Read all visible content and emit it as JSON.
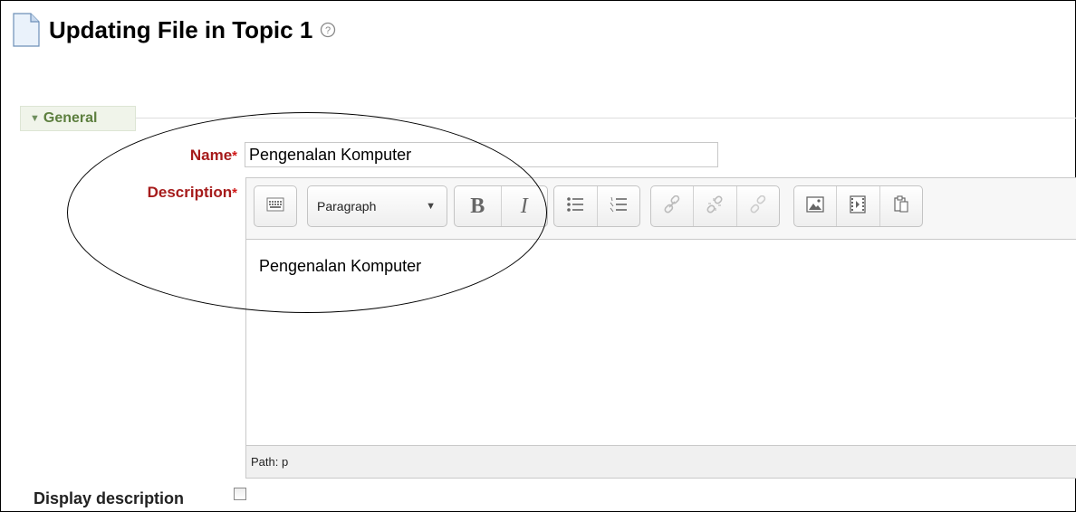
{
  "page": {
    "title": "Updating File in Topic 1",
    "icons": {
      "file": "file-icon",
      "help": "help-icon"
    }
  },
  "section": {
    "label": "General",
    "icon": "collapse-triangle-icon"
  },
  "form": {
    "name_label": "Name",
    "name_value": "Pengenalan Komputer",
    "required_mark": "*",
    "description_label": "Description",
    "display_description_label": "Display description",
    "display_description_checked": false
  },
  "editor": {
    "paragraph_select": "Paragraph",
    "bold": "B",
    "italic": "I",
    "content": "Pengenalan Komputer",
    "path": "Path: p",
    "toolbar_icons": [
      "toggle-toolbar-icon",
      "paragraph-dropdown",
      "bold-icon",
      "italic-icon",
      "unordered-list-icon",
      "ordered-list-icon",
      "link-icon",
      "unlink-icon",
      "anchor-icon",
      "image-icon",
      "media-icon",
      "paste-icon"
    ]
  },
  "colors": {
    "required_label": "#a61b1b",
    "legend_text": "#5d7f3f",
    "legend_bg": "#f0f4ea"
  }
}
